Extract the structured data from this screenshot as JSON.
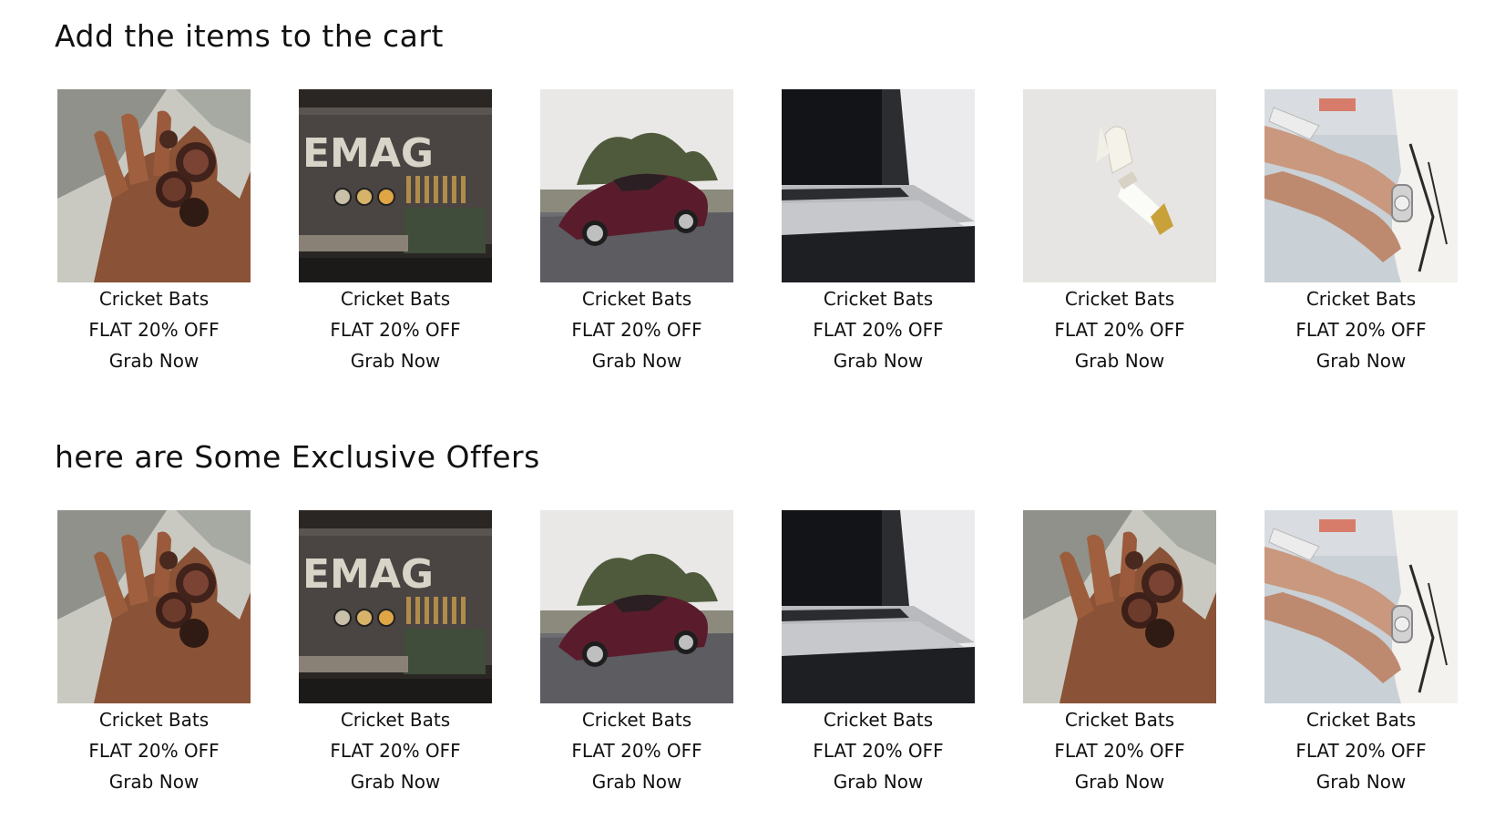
{
  "sections": [
    {
      "title": "Add the items to the cart",
      "products": [
        {
          "image": "rings-on-hand-image",
          "title": "Cricket Bats",
          "offer": "FLAT 20% OFF",
          "cta": "Grab Now"
        },
        {
          "image": "vintage-machine-image",
          "title": "Cricket Bats",
          "offer": "FLAT 20% OFF",
          "cta": "Grab Now"
        },
        {
          "image": "sports-car-image",
          "title": "Cricket Bats",
          "offer": "FLAT 20% OFF",
          "cta": "Grab Now"
        },
        {
          "image": "laptop-image",
          "title": "Cricket Bats",
          "offer": "FLAT 20% OFF",
          "cta": "Grab Now"
        },
        {
          "image": "perfume-bottle-image",
          "title": "Cricket Bats",
          "offer": "FLAT 20% OFF",
          "cta": "Grab Now"
        },
        {
          "image": "phone-in-hands-image",
          "title": "Cricket Bats",
          "offer": "FLAT 20% OFF",
          "cta": "Grab Now"
        }
      ]
    },
    {
      "title": "here are Some Exclusive Offers",
      "products": [
        {
          "image": "rings-on-hand-image",
          "title": "Cricket Bats",
          "offer": "FLAT 20% OFF",
          "cta": "Grab Now"
        },
        {
          "image": "vintage-machine-image",
          "title": "Cricket Bats",
          "offer": "FLAT 20% OFF",
          "cta": "Grab Now"
        },
        {
          "image": "sports-car-image",
          "title": "Cricket Bats",
          "offer": "FLAT 20% OFF",
          "cta": "Grab Now"
        },
        {
          "image": "laptop-image",
          "title": "Cricket Bats",
          "offer": "FLAT 20% OFF",
          "cta": "Grab Now"
        },
        {
          "image": "rings-on-hand-image",
          "title": "Cricket Bats",
          "offer": "FLAT 20% OFF",
          "cta": "Grab Now"
        },
        {
          "image": "phone-in-hands-image",
          "title": "Cricket Bats",
          "offer": "FLAT 20% OFF",
          "cta": "Grab Now"
        }
      ]
    }
  ],
  "theme": {
    "background": "#ffffff",
    "text": "#111111"
  }
}
